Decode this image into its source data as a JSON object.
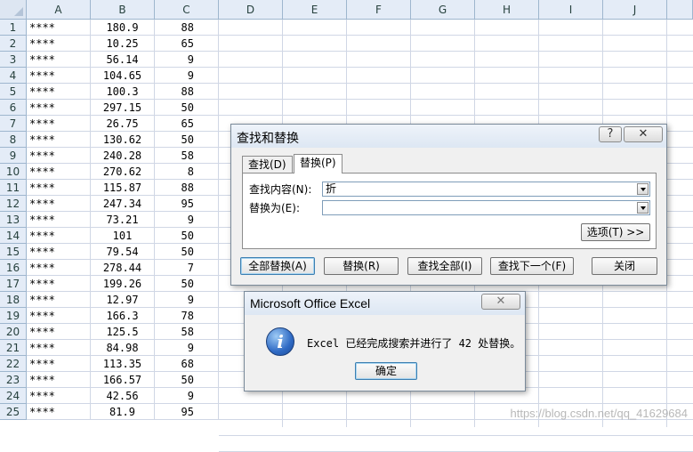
{
  "sheet": {
    "columns": [
      "A",
      "B",
      "C",
      "D",
      "E",
      "F",
      "G",
      "H",
      "I",
      "J"
    ],
    "rows": [
      {
        "num": "1",
        "a": "****",
        "b": "180.9",
        "c": "88"
      },
      {
        "num": "2",
        "a": "****",
        "b": "10.25",
        "c": "65"
      },
      {
        "num": "3",
        "a": "****",
        "b": "56.14",
        "c": "9"
      },
      {
        "num": "4",
        "a": "****",
        "b": "104.65",
        "c": "9"
      },
      {
        "num": "5",
        "a": "****",
        "b": "100.3",
        "c": "88"
      },
      {
        "num": "6",
        "a": "****",
        "b": "297.15",
        "c": "50"
      },
      {
        "num": "7",
        "a": "****",
        "b": "26.75",
        "c": "65"
      },
      {
        "num": "8",
        "a": "****",
        "b": "130.62",
        "c": "50"
      },
      {
        "num": "9",
        "a": "****",
        "b": "240.28",
        "c": "58"
      },
      {
        "num": "10",
        "a": "****",
        "b": "270.62",
        "c": "8"
      },
      {
        "num": "11",
        "a": "****",
        "b": "115.87",
        "c": "88"
      },
      {
        "num": "12",
        "a": "****",
        "b": "247.34",
        "c": "95"
      },
      {
        "num": "13",
        "a": "****",
        "b": "73.21",
        "c": "9"
      },
      {
        "num": "14",
        "a": "****",
        "b": "101",
        "c": "50"
      },
      {
        "num": "15",
        "a": "****",
        "b": "79.54",
        "c": "50"
      },
      {
        "num": "16",
        "a": "****",
        "b": "278.44",
        "c": "7"
      },
      {
        "num": "17",
        "a": "****",
        "b": "199.26",
        "c": "50"
      },
      {
        "num": "18",
        "a": "****",
        "b": "12.97",
        "c": "9"
      },
      {
        "num": "19",
        "a": "****",
        "b": "166.3",
        "c": "78"
      },
      {
        "num": "20",
        "a": "****",
        "b": "125.5",
        "c": "58"
      },
      {
        "num": "21",
        "a": "****",
        "b": "84.98",
        "c": "9"
      },
      {
        "num": "22",
        "a": "****",
        "b": "113.35",
        "c": "68"
      },
      {
        "num": "23",
        "a": "****",
        "b": "166.57",
        "c": "50"
      },
      {
        "num": "24",
        "a": "****",
        "b": "42.56",
        "c": "9"
      },
      {
        "num": "25",
        "a": "****",
        "b": "81.9",
        "c": "95"
      }
    ]
  },
  "find_replace": {
    "title": "查找和替换",
    "help_glyph": "?",
    "close_glyph": "✕",
    "tabs": [
      {
        "label": "查找(D)",
        "active": false
      },
      {
        "label": "替换(P)",
        "active": true
      }
    ],
    "find_label": "查找内容(N):",
    "find_value": "折",
    "replace_label": "替换为(E):",
    "replace_value": "",
    "options_button": "选项(T) >>",
    "buttons": {
      "replace_all": "全部替换(A)",
      "replace": "替换(R)",
      "find_all": "查找全部(I)",
      "find_next": "查找下一个(F)",
      "close": "关闭"
    }
  },
  "message_box": {
    "title": "Microsoft Office Excel",
    "close_glyph": "✕",
    "icon_glyph": "i",
    "message": "Excel 已经完成搜索并进行了 42 处替换。",
    "ok_button": "确定"
  },
  "watermark": "https://blog.csdn.net/qq_41629684"
}
